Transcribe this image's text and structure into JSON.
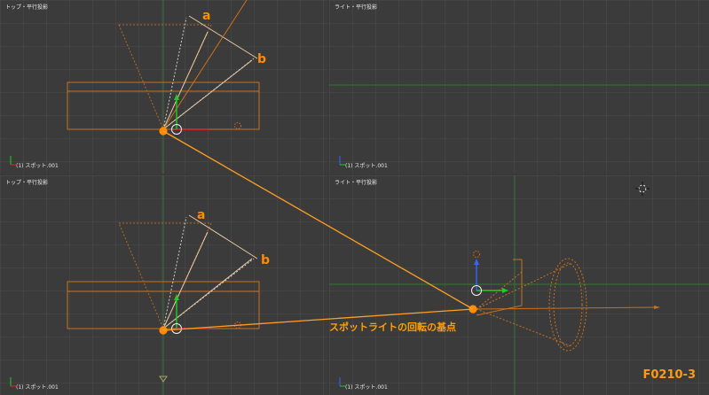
{
  "colors": {
    "accent": "#ff8c00",
    "object_line": "#d9761c",
    "background": "#3b3b3b",
    "axis_x": "#ee2222",
    "axis_y": "#22cc22",
    "axis_z": "#3366ff"
  },
  "viewports": {
    "top_left": {
      "title": "トップ・平行投影",
      "footer": "(1) スポット.001"
    },
    "top_right": {
      "title": "ライト・平行投影",
      "footer": "(1) スポット.001"
    },
    "bottom_left": {
      "title": "トップ・平行投影",
      "footer": "(1) スポット.001"
    },
    "bottom_right": {
      "title": "ライト・平行投影",
      "footer": "(1) スポット.001"
    }
  },
  "labels": {
    "a_top": "a",
    "b_top": "b",
    "a_bottom": "a",
    "b_bottom": "b",
    "caption": "スポットライトの回転の基点",
    "figure_code": "F0210-3"
  },
  "icons": [
    "3d-cursor-icon",
    "transform-gizmo-icon",
    "lamp-icon",
    "axis-widget-icon"
  ]
}
